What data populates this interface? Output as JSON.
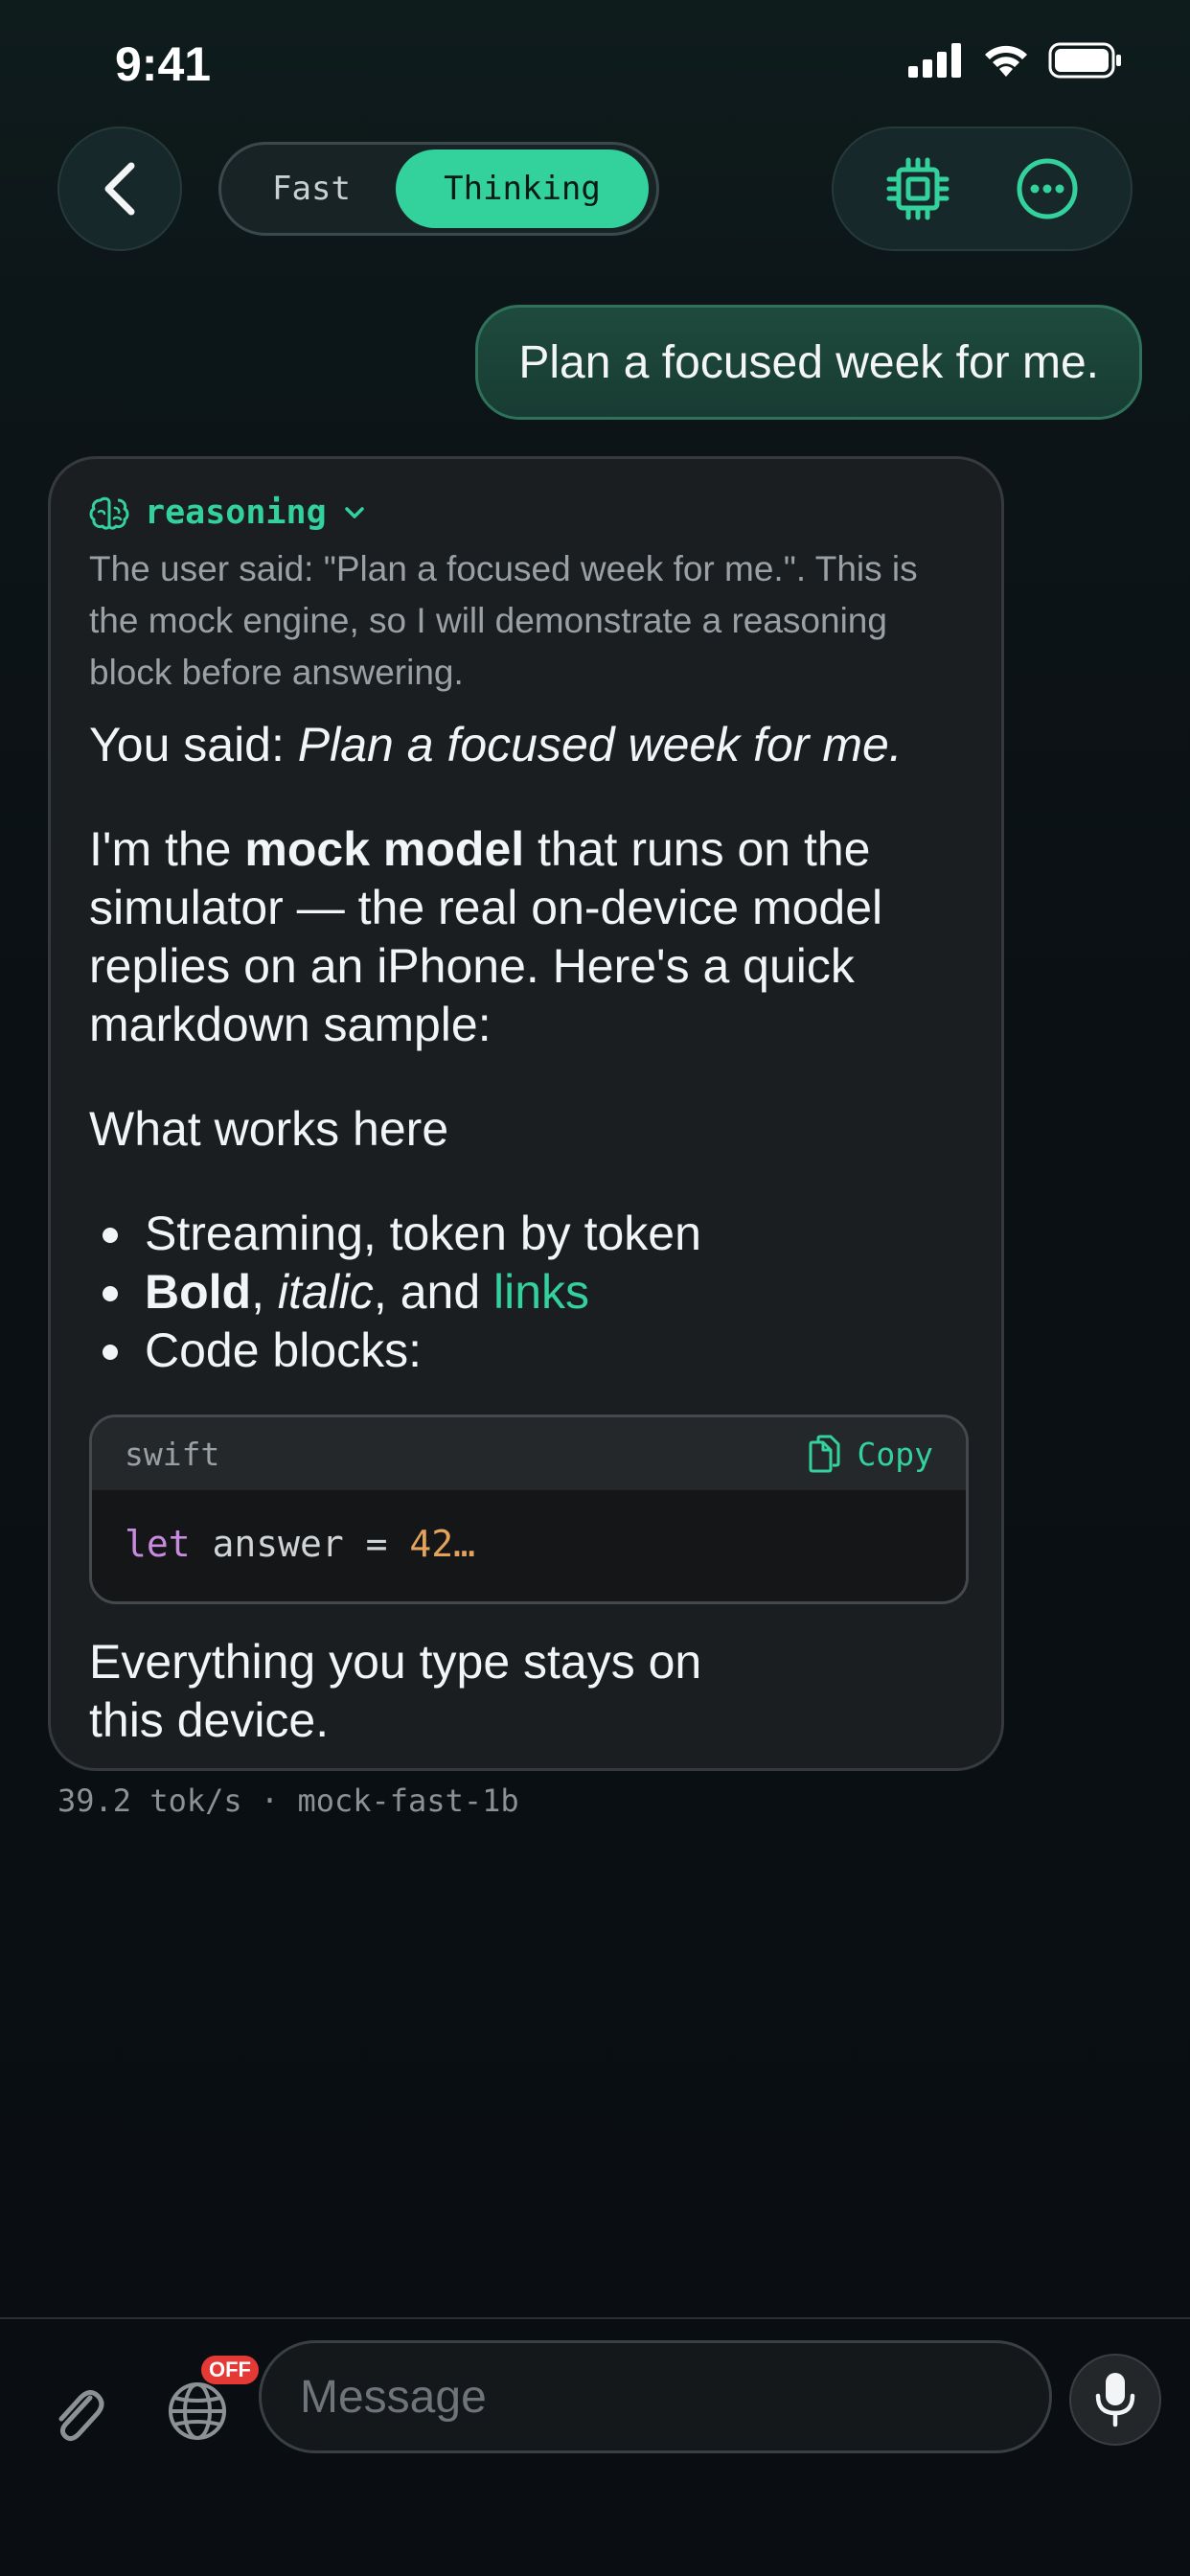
{
  "status_bar": {
    "time": "9:41"
  },
  "header": {
    "mode_options": [
      "Fast",
      "Thinking"
    ],
    "selected_mode": "Thinking",
    "icons": {
      "back": "chevron-left-icon",
      "model": "cpu-chip-icon",
      "more": "ellipsis-circle-icon"
    }
  },
  "conversation": {
    "user_message": "Plan a focused week for me.",
    "assistant": {
      "reasoning_label": "reasoning",
      "reasoning_text": "The user said: \"Plan a focused week for me.\". This is the mock engine, so I will demonstrate a reasoning block before answering.",
      "p1_prefix": "You said: ",
      "p1_italic": "Plan a focused week for me.",
      "p2_a": "I'm the ",
      "p2_bold": "mock model",
      "p2_b": " that runs on the simulator — the real on-device model replies on an iPhone. Here's a quick markdown sample:",
      "p3": "What works here",
      "bullet1": "Streaming, token by token",
      "bullet2_bold": "Bold",
      "bullet2_sep1": ", ",
      "bullet2_italic": "italic",
      "bullet2_sep2": ", and ",
      "bullet2_link": "links",
      "bullet3": "Code blocks:",
      "code": {
        "language": "swift",
        "copy_label": "Copy",
        "keyword": "let",
        "mid": " answer = ",
        "value": "42…"
      },
      "p4": "Everything you type stays on this device."
    },
    "meta": "39.2 tok/s · mock-fast-1b"
  },
  "input_bar": {
    "placeholder": "Message",
    "web_badge": "OFF",
    "icons": {
      "attach": "paperclip-icon",
      "web": "globe-icon",
      "mic": "microphone-icon"
    }
  },
  "colors": {
    "accent": "#33d29c",
    "badge": "#e53935"
  }
}
